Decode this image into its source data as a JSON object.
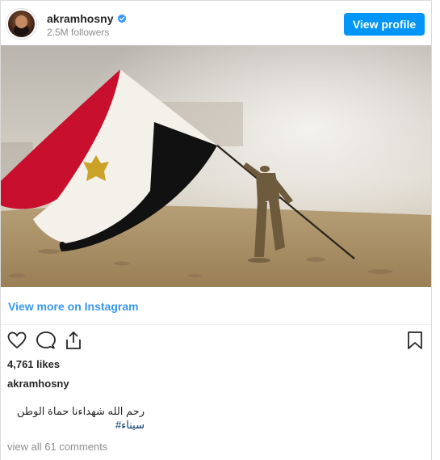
{
  "header": {
    "username": "akramhosny",
    "followers": "2.5M followers",
    "view_profile_label": "View profile"
  },
  "post": {
    "image_alt": "Soldier running with an Egyptian flag",
    "view_more_label": "View more on Instagram",
    "likes": "4,761 likes",
    "author": "akramhosny",
    "caption_line1": "رحم الله شهداءنا حماة الوطن",
    "caption_hashtag": "سيناء#",
    "view_comments_label": "view all 61 comments"
  },
  "colors": {
    "accent": "#0095f6",
    "link": "#3897f0",
    "hashtag": "#003569",
    "flag_red": "#c8102e",
    "flag_black": "#111111"
  },
  "icons": [
    "verified-icon",
    "heart-icon",
    "comment-icon",
    "share-icon",
    "bookmark-icon"
  ]
}
